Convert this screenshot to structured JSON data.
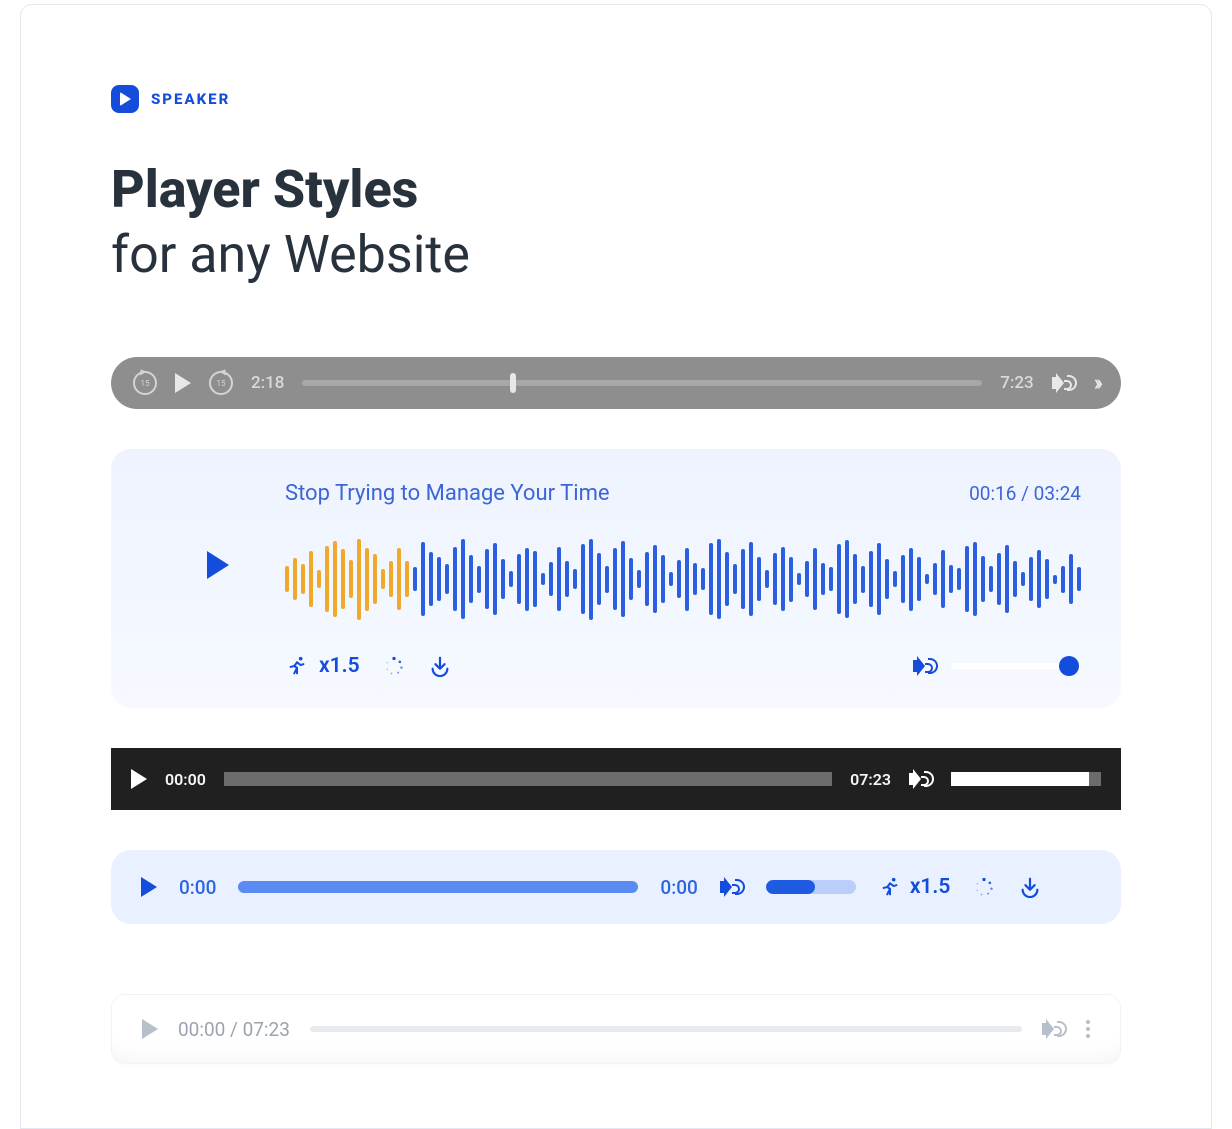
{
  "brand": {
    "name": "SPEAKER"
  },
  "heading": {
    "line1": "Player Styles",
    "line2": "for any Website"
  },
  "player1": {
    "rewind_label": "15",
    "forward_label": "15",
    "current_time": "2:18",
    "duration": "7:23",
    "progress_pct": 31
  },
  "player2": {
    "title": "Stop Trying to Manage Your Time",
    "time_display": "00:16 / 03:24",
    "progress_pct": 16,
    "speed_label": "x1.5",
    "volume_pct": 88,
    "waveform_heights": [
      28,
      46,
      34,
      62,
      20,
      74,
      84,
      66,
      42,
      90,
      70,
      56,
      22,
      40,
      68,
      40,
      26,
      82,
      60,
      48,
      34,
      72,
      88,
      54,
      30,
      66,
      80,
      44,
      18,
      56,
      70,
      62,
      14,
      38,
      72,
      40,
      22,
      78,
      90,
      58,
      30,
      68,
      84,
      46,
      20,
      60,
      76,
      54,
      16,
      42,
      70,
      36,
      24,
      80,
      88,
      60,
      34,
      66,
      82,
      48,
      20,
      58,
      72,
      50,
      14,
      40,
      68,
      36,
      26,
      78,
      86,
      56,
      30,
      62,
      80,
      44,
      18,
      54,
      70,
      48,
      12,
      36,
      64,
      32,
      24,
      74,
      82,
      52,
      28,
      58,
      76,
      40,
      16,
      48,
      64,
      44,
      10,
      30,
      56,
      26
    ]
  },
  "player3": {
    "current_time": "00:00",
    "duration": "07:23",
    "volume_pct": 92
  },
  "player4": {
    "current_time": "0:00",
    "duration": "0:00",
    "speed_label": "x1.5",
    "volume_pct": 55
  },
  "player5": {
    "time_display": "00:00 / 07:23"
  },
  "colors": {
    "accent": "#144cdb",
    "wave_played": "#f0a92a",
    "wave_unplayed": "#2b5fe0"
  }
}
